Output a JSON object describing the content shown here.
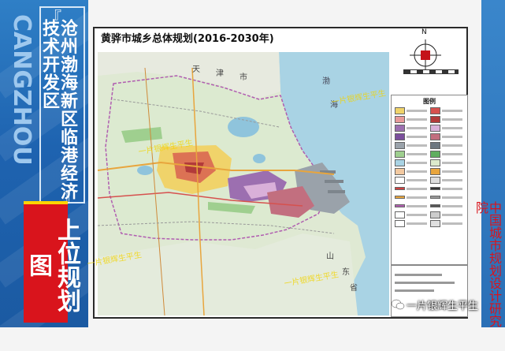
{
  "left_panel": {
    "city_en": "CANGZHOU",
    "district_name": "沧州渤海新区临港经济技术开发区",
    "section_label": "上位规划图",
    "quote_open": "『",
    "quote_close": "』"
  },
  "right_panel": {
    "institute": "中国城市规划设计研究院"
  },
  "map": {
    "title": "黄骅市城乡总体规划(2016-2030年)",
    "north_label": "N",
    "legend_title": "图例",
    "place_labels": [
      "天",
      "津",
      "市",
      "渤",
      "海",
      "山",
      "东",
      "省"
    ]
  },
  "watermark": "一片银辉生平生",
  "icons": {
    "north_arrow": "north-arrow-icon",
    "wechat": "wechat-icon"
  },
  "colors": {
    "left_band": "#1e63b0",
    "red_label": "#d9141c",
    "sea": "#a9d3e4",
    "land": "#dceacc",
    "urban_red": "#d6514e",
    "industrial_purple": "#9c6fb0",
    "residential_yellow": "#f0d36a",
    "port_gray": "#9aa2aa"
  }
}
